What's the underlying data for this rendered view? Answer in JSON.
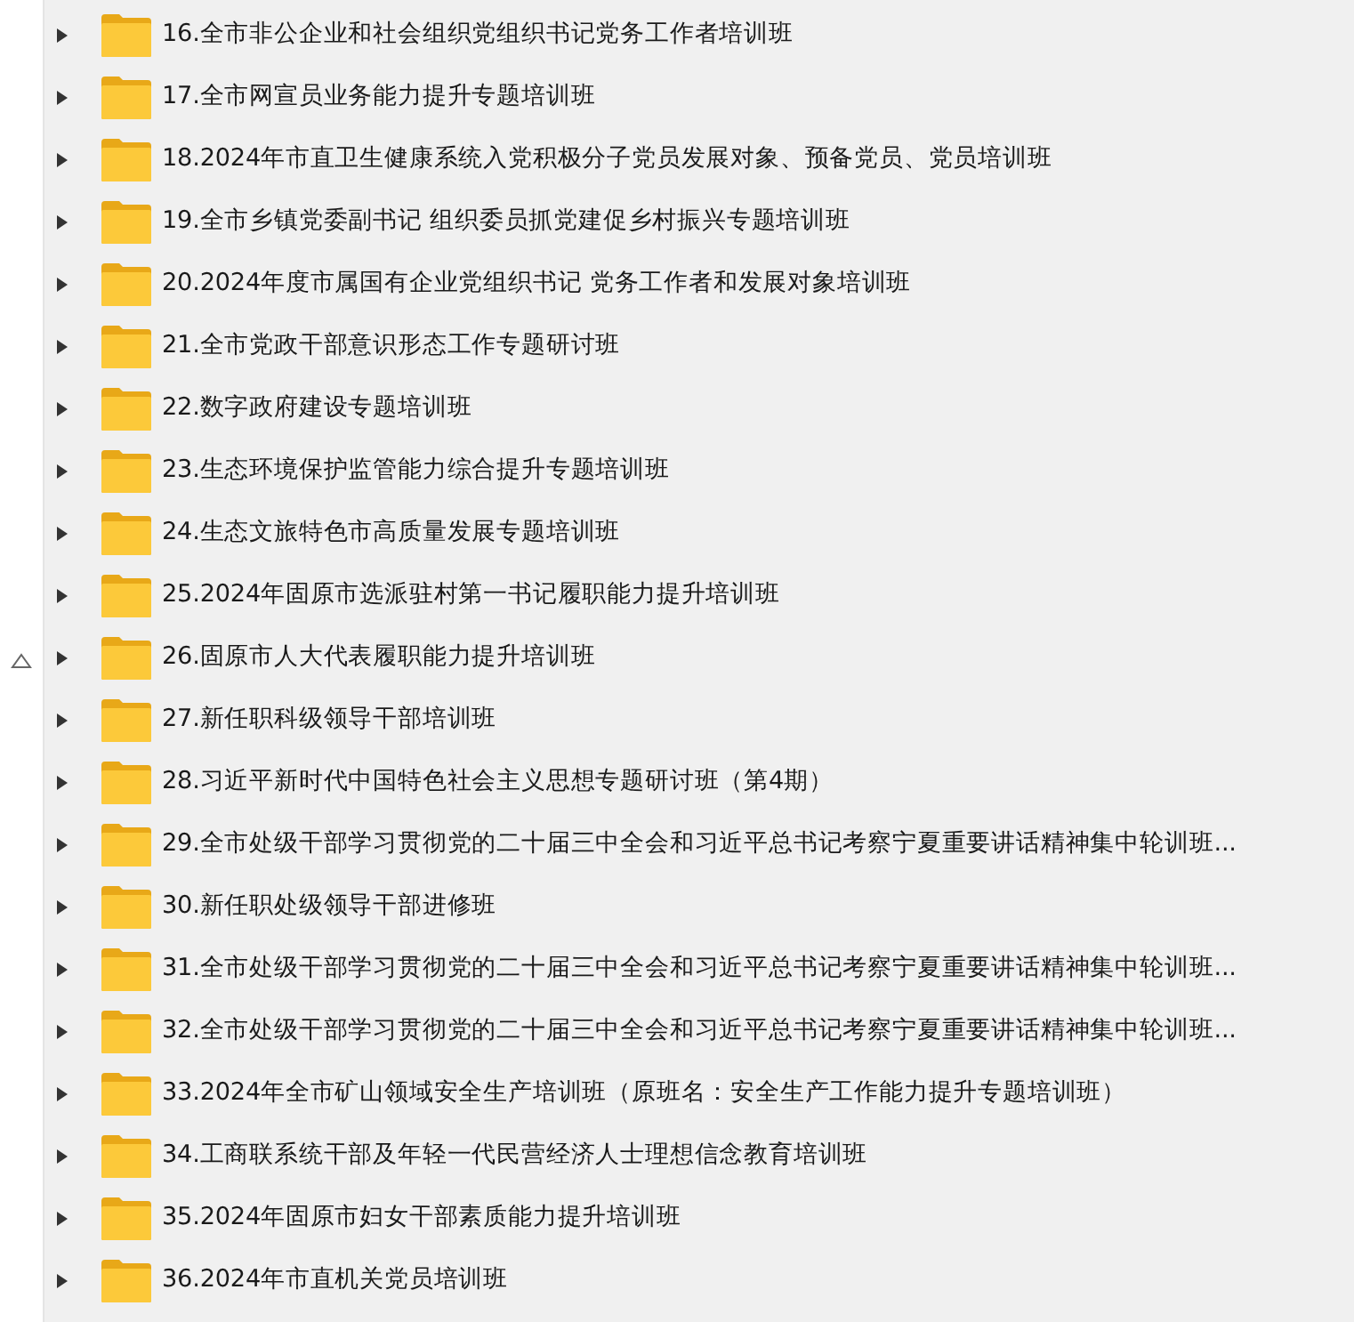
{
  "folders": [
    {
      "label": "16.全市非公企业和社会组织党组织书记党务工作者培训班",
      "expanded": false
    },
    {
      "label": "17.全市网宣员业务能力提升专题培训班",
      "expanded": false
    },
    {
      "label": "18.2024年市直卫生健康系统入党积极分子党员发展对象、预备党员、党员培训班",
      "expanded": false
    },
    {
      "label": "19.全市乡镇党委副书记 组织委员抓党建促乡村振兴专题培训班",
      "expanded": false
    },
    {
      "label": "20.2024年度市属国有企业党组织书记 党务工作者和发展对象培训班",
      "expanded": false
    },
    {
      "label": "21.全市党政干部意识形态工作专题研讨班",
      "expanded": false
    },
    {
      "label": "22.数字政府建设专题培训班",
      "expanded": false
    },
    {
      "label": "23.生态环境保护监管能力综合提升专题培训班",
      "expanded": false
    },
    {
      "label": "24.生态文旅特色市高质量发展专题培训班",
      "expanded": false
    },
    {
      "label": "25.2024年固原市选派驻村第一书记履职能力提升培训班",
      "expanded": false
    },
    {
      "label": "26.固原市人大代表履职能力提升培训班",
      "expanded": false
    },
    {
      "label": "27.新任职科级领导干部培训班",
      "expanded": false
    },
    {
      "label": "28.习近平新时代中国特色社会主义思想专题研讨班（第4期）",
      "expanded": false
    },
    {
      "label": "29.全市处级干部学习贯彻党的二十届三中全会和习近平总书记考察宁夏重要讲话精神集中轮训班...",
      "expanded": false
    },
    {
      "label": "30.新任职处级领导干部进修班",
      "expanded": false
    },
    {
      "label": "31.全市处级干部学习贯彻党的二十届三中全会和习近平总书记考察宁夏重要讲话精神集中轮训班...",
      "expanded": false
    },
    {
      "label": "32.全市处级干部学习贯彻党的二十届三中全会和习近平总书记考察宁夏重要讲话精神集中轮训班...",
      "expanded": false
    },
    {
      "label": "33.2024年全市矿山领域安全生产培训班（原班名：安全生产工作能力提升专题培训班）",
      "expanded": false
    },
    {
      "label": "34.工商联系统干部及年轻一代民营经济人士理想信念教育培训班",
      "expanded": false
    },
    {
      "label": "35.2024年固原市妇女干部素质能力提升培训班",
      "expanded": false
    },
    {
      "label": "36.2024年市直机关党员培训班",
      "expanded": false
    }
  ]
}
